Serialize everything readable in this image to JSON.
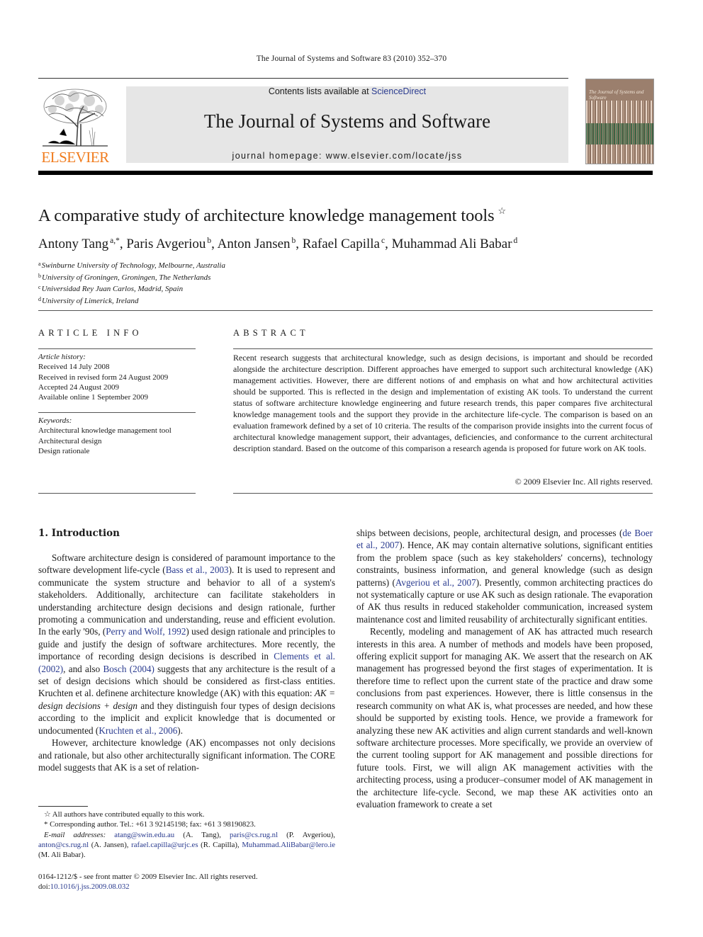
{
  "running_head": "The Journal of Systems and Software 83 (2010) 352–370",
  "masthead": {
    "contents_prefix": "Contents lists available at ",
    "contents_link": "ScienceDirect",
    "journal_title": "The Journal of Systems and Software",
    "homepage": "journal homepage: www.elsevier.com/locate/jss",
    "publisher_logo": "ELSEVIER",
    "cover_title": "The Journal of Systems and Software",
    "colors": {
      "publisher_orange": "#f07c1e",
      "link_blue": "#2a3b8f",
      "masthead_bg": "#e6e6e6"
    }
  },
  "paper": {
    "title": "A comparative study of architecture knowledge management tools",
    "title_mark": "☆",
    "authors": [
      {
        "name": "Antony Tang",
        "sup": "a,*"
      },
      {
        "name": "Paris Avgeriou",
        "sup": "b"
      },
      {
        "name": "Anton Jansen",
        "sup": "b"
      },
      {
        "name": "Rafael Capilla",
        "sup": "c"
      },
      {
        "name": "Muhammad Ali Babar",
        "sup": "d"
      }
    ],
    "affiliations": [
      {
        "key": "a",
        "text": "Swinburne University of Technology, Melbourne, Australia"
      },
      {
        "key": "b",
        "text": "University of Groningen, Groningen, The Netherlands"
      },
      {
        "key": "c",
        "text": "Universidad Rey Juan Carlos, Madrid, Spain"
      },
      {
        "key": "d",
        "text": "University of Limerick, Ireland"
      }
    ]
  },
  "article_info": {
    "heading": "ARTICLE INFO",
    "history_label": "Article history:",
    "history": [
      "Received 14 July 2008",
      "Received in revised form 24 August 2009",
      "Accepted 24 August 2009",
      "Available online 1 September 2009"
    ],
    "keywords_label": "Keywords:",
    "keywords": [
      "Architectural knowledge management tool",
      "Architectural design",
      "Design rationale"
    ]
  },
  "abstract": {
    "heading": "ABSTRACT",
    "text": "Recent research suggests that architectural knowledge, such as design decisions, is important and should be recorded alongside the architecture description. Different approaches have emerged to support such architectural knowledge (AK) management activities. However, there are different notions of and emphasis on what and how architectural activities should be supported. This is reflected in the design and implementation of existing AK tools. To understand the current status of software architecture knowledge engineering and future research trends, this paper compares five architectural knowledge management tools and the support they provide in the architecture life-cycle. The comparison is based on an evaluation framework defined by a set of 10 criteria. The results of the comparison provide insights into the current focus of architectural knowledge management support, their advantages, deficiencies, and conformance to the current architectural description standard. Based on the outcome of this comparison a research agenda is proposed for future work on AK tools.",
    "copyright": "© 2009 Elsevier Inc. All rights reserved."
  },
  "introduction": {
    "heading": "1. Introduction",
    "p1": [
      {
        "t": "Software architecture design is considered of paramount importance to the software development life-cycle ("
      },
      {
        "t": "Bass et al., 2003",
        "link": true
      },
      {
        "t": "). It is used to represent and communicate the system structure and behavior to all of a system's stakeholders. Additionally, architecture can facilitate stakeholders in understanding architecture design decisions and design rationale, further promoting a communication and understanding, reuse and efficient evolution. In the early '90s, ("
      },
      {
        "t": "Perry and Wolf, 1992",
        "link": true
      },
      {
        "t": ") used design rationale and principles to guide and justify the design of software architectures. More recently, the importance of recording design decisions is described in "
      },
      {
        "t": "Clements et al. (2002)",
        "link": true
      },
      {
        "t": ", and also "
      },
      {
        "t": "Bosch (2004)",
        "link": true
      },
      {
        "t": " suggests that any architecture is the result of a set of design decisions which should be considered as first-class entities. Kruchten et al. definene architecture knowledge (AK) with this equation: "
      },
      {
        "t": "AK = design decisions + design",
        "italic": true
      },
      {
        "t": " and they distinguish four types of design decisions according to the implicit and explicit knowledge that is documented or undocumented ("
      },
      {
        "t": "Kruchten et al., 2006",
        "link": true
      },
      {
        "t": ")."
      }
    ],
    "p2": [
      {
        "t": "However, architecture knowledge (AK) encompasses not only decisions and rationale, but also other architecturally significant information. The CORE model suggests that AK is a set of relationships between decisions, people, architectural design, and processes ("
      },
      {
        "t": "de Boer et al., 2007",
        "link": true
      },
      {
        "t": "). Hence, AK may contain alternative solutions, significant entities from the problem space (such as key stakeholders' concerns), technology constraints, business information, and general knowledge (such as design patterns) ("
      },
      {
        "t": "Avgeriou et al., 2007",
        "link": true
      },
      {
        "t": "). Presently, common architecting practices do not systematically capture or use AK such as design rationale. The evaporation of AK thus results in reduced stakeholder communication, increased system maintenance cost and limited reusability of architecturally significant entities."
      }
    ],
    "p3": [
      {
        "t": "Recently, modeling and management of AK has attracted much research interests in this area. A number of methods and models have been proposed, offering explicit support for managing AK. We assert that the research on AK management has progressed beyond the first stages of experimentation. It is therefore time to reflect upon the current state of the practice and draw some conclusions from past experiences. However, there is little consensus in the research community on what AK is, what processes are needed, and how these should be supported by existing tools. Hence, we provide a framework for analyzing these new AK activities and align current standards and well-known software architecture processes. More specifically, we provide an overview of the current tooling support for AK management and possible directions for future tools. First, we will align AK management activities with the architecting process, using a producer–consumer model of AK management in the architecture life-cycle. Second, we map these AK activities onto an evaluation framework to create a set"
      }
    ]
  },
  "footnotes": {
    "star_note": "All authors have contributed equally to this work.",
    "corresponding": "Corresponding author. Tel.: +61 3 92145198; fax: +61 3 98190823.",
    "email_label": "E-mail addresses:",
    "emails": [
      {
        "addr": "atang@swin.edu.au",
        "who": "(A. Tang)"
      },
      {
        "addr": "paris@cs.rug.nl",
        "who": "(P. Avgeriou)"
      },
      {
        "addr": "anton@cs.rug.nl",
        "who": "(A. Jansen)"
      },
      {
        "addr": "rafael.capilla@urjc.es",
        "who": "(R. Capilla)"
      },
      {
        "addr": "Muhammad.AliBabar@lero.ie",
        "who": "(M. Ali Babar)."
      }
    ]
  },
  "issn_line": "0164-1212/$ - see front matter © 2009 Elsevier Inc. All rights reserved.",
  "doi_label": "doi:",
  "doi": "10.1016/j.jss.2009.08.032"
}
